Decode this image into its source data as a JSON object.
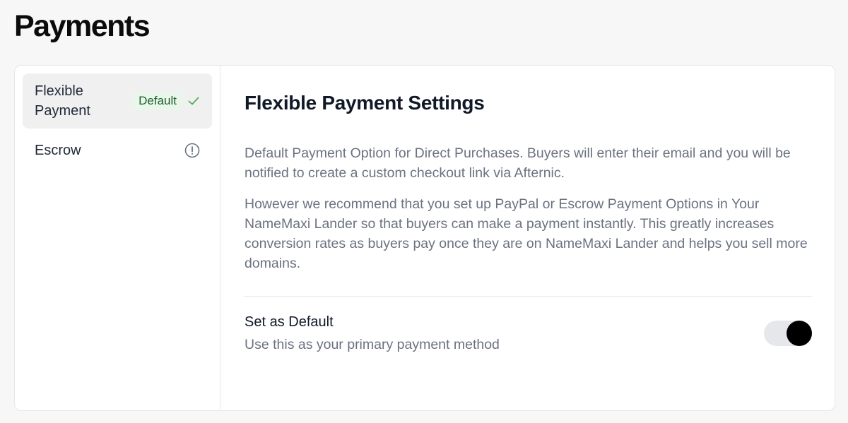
{
  "page": {
    "title": "Payments"
  },
  "sidebar": {
    "items": [
      {
        "label": "Flexible Payment",
        "badge": "Default",
        "status_icon": "check-icon",
        "active": true
      },
      {
        "label": "Escrow",
        "status_icon": "info-circle-icon",
        "active": false
      }
    ]
  },
  "main": {
    "title": "Flexible Payment Settings",
    "paragraphs": [
      "Default Payment Option for Direct Purchases. Buyers will enter their email and you will be notified to create a custom checkout link via Afternic.",
      "However we recommend that you set up PayPal or Escrow Payment Options in Your NameMaxi Lander so that buyers can make a payment instantly. This greatly increases conversion rates as buyers pay once they are on NameMaxi Lander and helps you sell more domains."
    ],
    "setting": {
      "title": "Set as Default",
      "description": "Use this as your primary payment method",
      "toggle_on": true
    }
  },
  "colors": {
    "badge_bg": "#e8f7ea",
    "badge_text": "#1f5f2e",
    "check": "#4caf50",
    "toggle_knob": "#000000",
    "toggle_track": "#e5e7eb"
  }
}
